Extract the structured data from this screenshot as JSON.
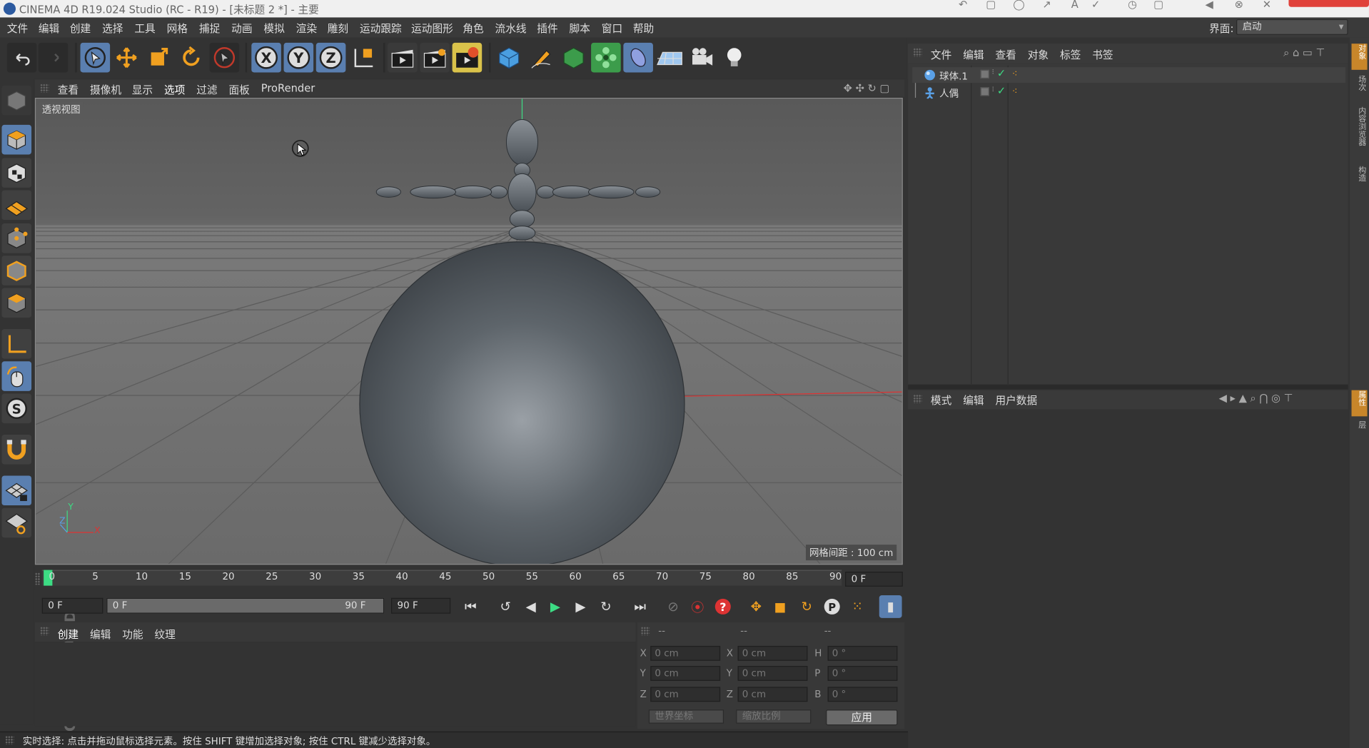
{
  "title_bar": {
    "title": "CINEMA 4D R19.024 Studio (RC - R19) - [未标题 2 *] - 主要"
  },
  "menubar": {
    "items": [
      "文件",
      "编辑",
      "创建",
      "选择",
      "工具",
      "网格",
      "捕捉",
      "动画",
      "模拟",
      "渲染",
      "雕刻",
      "运动跟踪",
      "运动图形",
      "角色",
      "流水线",
      "插件",
      "脚本",
      "窗口",
      "帮助"
    ],
    "interface_label": "界面:",
    "interface_value": "启动"
  },
  "viewport": {
    "menu": [
      "查看",
      "摄像机",
      "显示",
      "选项",
      "过滤",
      "面板",
      "ProRender"
    ],
    "view_name": "透视视图",
    "grid_spacing": "网格间距 : 100 cm",
    "axis_labels": {
      "y": "Y",
      "x": "X",
      "z": "Z"
    }
  },
  "timeline": {
    "ticks": [
      "0",
      "5",
      "10",
      "15",
      "20",
      "25",
      "30",
      "35",
      "40",
      "45",
      "50",
      "55",
      "60",
      "65",
      "70",
      "75",
      "80",
      "85",
      "90"
    ],
    "current_frame": "0 F"
  },
  "playback": {
    "start": "0 F",
    "range_start": "0 F",
    "range_end": "90 F",
    "end": "90 F"
  },
  "materials": {
    "menu": [
      "创建",
      "编辑",
      "功能",
      "纹理"
    ]
  },
  "coordinates": {
    "headers": [
      "--",
      "--",
      "--"
    ],
    "rows": [
      {
        "l1": "X",
        "v1": "0 cm",
        "l2": "X",
        "v2": "0 cm",
        "l3": "H",
        "v3": "0 °"
      },
      {
        "l1": "Y",
        "v1": "0 cm",
        "l2": "Y",
        "v2": "0 cm",
        "l3": "P",
        "v3": "0 °"
      },
      {
        "l1": "Z",
        "v1": "0 cm",
        "l2": "Z",
        "v2": "0 cm",
        "l3": "B",
        "v3": "0 °"
      }
    ],
    "dropdown1": "世界坐标",
    "dropdown2": "缩放比例",
    "apply": "应用"
  },
  "status": {
    "text": "实时选择: 点击并拖动鼠标选择元素。按住 SHIFT 键增加选择对象; 按住 CTRL 键减少选择对象。"
  },
  "object_manager": {
    "menu": [
      "文件",
      "编辑",
      "查看",
      "对象",
      "标签",
      "书签"
    ],
    "objects": [
      {
        "name": "球体.1",
        "icon": "sphere-icon",
        "icon_color": "#5aa0e6"
      },
      {
        "name": "人偶",
        "icon": "figure-icon",
        "icon_color": "#5aa0e6"
      }
    ]
  },
  "attribute_manager": {
    "menu": [
      "模式",
      "编辑",
      "用户数据"
    ]
  },
  "right_tabs": {
    "object_tabs": [
      "对象",
      "场次",
      "内容浏览器",
      "构造"
    ],
    "attr_tabs": [
      "属性",
      "层"
    ]
  },
  "branding": {
    "logo": "MAXON CINEMA 4D"
  },
  "colors": {
    "accent": "#5a7fb0",
    "timeline_cursor": "#3ddc84",
    "tab_active": "#c8862a"
  }
}
